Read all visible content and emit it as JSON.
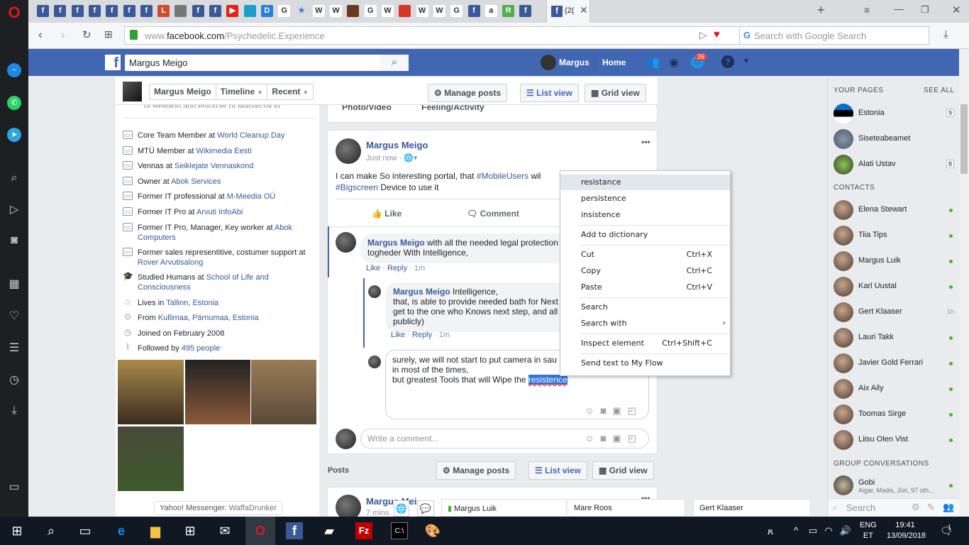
{
  "browser": {
    "active_tab_title": "(2(",
    "url_prefix": "www.",
    "url_domain": "facebook.com",
    "url_path": "/Psychedelic.Experience",
    "search_placeholder": "Search with Google Search",
    "new_tab": "+",
    "tab_icons": [
      "f",
      "f",
      "f",
      "f",
      "f",
      "f",
      "f",
      "L",
      "doc",
      "f",
      "f",
      "youtube",
      "blue",
      "D",
      "G",
      "★",
      "W",
      "W",
      "brown",
      "G",
      "W",
      "red",
      "W",
      "W",
      "G",
      "f",
      "a",
      "R",
      "f",
      "f"
    ]
  },
  "fb_header": {
    "search_value": "Margus Meigo",
    "user_name": "Margus",
    "home": "Home",
    "notification_count": "26",
    "brand_color": "#4267b2"
  },
  "profile_bar": {
    "name": "Margus Meigo",
    "timeline": "Timeline",
    "recent": "Recent",
    "manage_posts": "Manage posts",
    "list_view": "List view",
    "grid_view": "Grid view"
  },
  "intro": {
    "cut_text": "of Religion and enforcer of Manarchy in",
    "items": [
      {
        "icon": "briefcase",
        "text": "Core Team Member at ",
        "link": "World Cleanup Day"
      },
      {
        "icon": "briefcase",
        "text": "MTÜ Member at ",
        "link": "Wikimedia Eesti"
      },
      {
        "icon": "briefcase",
        "text": "Vennas at ",
        "link": "Seiklejate Vennaskond"
      },
      {
        "icon": "briefcase",
        "text": "Owner at ",
        "link": "Abok Services"
      },
      {
        "icon": "briefcase",
        "text": "Former IT professional at ",
        "link": "M-Meedia OÜ"
      },
      {
        "icon": "briefcase",
        "text": "Former IT Pro at ",
        "link": "Arvuti InfoAbi"
      },
      {
        "icon": "briefcase",
        "text": "Former IT Pro, Manager, Key worker at ",
        "link": "Abok Computers"
      },
      {
        "icon": "briefcase",
        "text": "Former sales representitive, costumer support at ",
        "link": "Rover Arvutisalong"
      },
      {
        "icon": "graduation-cap",
        "text": "Studied Humans at ",
        "link": "School of Life and Consciousness"
      },
      {
        "icon": "home",
        "text": "Lives in ",
        "link": "Tallinn, Estonia"
      },
      {
        "icon": "pin",
        "text": "From ",
        "link": "Kullimaa, Pärnumaa, Estonia"
      },
      {
        "icon": "clock",
        "text": "Joined on February 2008",
        "link": ""
      },
      {
        "icon": "rss",
        "text": "Followed by ",
        "link": "495 people"
      }
    ],
    "yahoo_label": "Yahoo! Messenger: ",
    "yahoo_value": "WaffaDrunker"
  },
  "composer": {
    "photo_video": "Photo/Video",
    "feeling": "Feeling/Activity"
  },
  "post": {
    "author": "Margus Meigo",
    "time": "Just now",
    "text_before": "I can make So interesting portal, that ",
    "hashtag1": "#MobileUsers",
    "text_mid": " wil",
    "hashtag2": "#Bigscreen",
    "text_after": " Device to use it",
    "like": "Like",
    "comment": "Comment",
    "comments": [
      {
        "author": "Margus Meigo",
        "text": " with all the needed legal protection",
        "text2": "togheder With Intelligence,",
        "like": "Like",
        "reply": "Reply",
        "time": "1m"
      },
      {
        "author": "Margus Meigo",
        "text": " Intelligence,",
        "text2": "that, is able to provide needed bath for Next",
        "text3": "get to the one who Knows next step, and all",
        "text4": "publicly)",
        "like": "Like",
        "reply": "Reply",
        "time": "1m"
      }
    ],
    "draft_line1": "surely, we will not start to put camera in sau",
    "draft_line2": "in most of the times,",
    "draft_line3": "but greatest Tools that will Wipe the ",
    "draft_selected": "resistence",
    "write_placeholder": "Write a comment..."
  },
  "posts_section": {
    "label": "Posts",
    "manage_posts": "Manage posts",
    "list_view": "List view",
    "grid_view": "Grid view",
    "next_author": "Margus Mei",
    "next_time": "7 mins"
  },
  "context_menu": {
    "suggestions": [
      "resistance",
      "persistence",
      "insistence"
    ],
    "add_to_dictionary": "Add to dictionary",
    "cut": "Cut",
    "cut_sc": "Ctrl+X",
    "copy": "Copy",
    "copy_sc": "Ctrl+C",
    "paste": "Paste",
    "paste_sc": "Ctrl+V",
    "search": "Search",
    "search_with": "Search with",
    "inspect": "Inspect element",
    "inspect_sc": "Ctrl+Shift+C",
    "send_flow": "Send text to My Flow"
  },
  "sidebar": {
    "your_pages": "YOUR PAGES",
    "see_all": "SEE ALL",
    "pages": [
      {
        "name": "Estonia",
        "badge": "9"
      },
      {
        "name": "Siseteabeamet",
        "badge": ""
      },
      {
        "name": "Alati Ustav",
        "badge": "8"
      }
    ],
    "contacts_label": "CONTACTS",
    "contacts": [
      {
        "name": "Elena Stewart",
        "status": "online"
      },
      {
        "name": "Tiia Tips",
        "status": "online"
      },
      {
        "name": "Margus Luik",
        "status": "online"
      },
      {
        "name": "Karl Uustal",
        "status": "online"
      },
      {
        "name": "Gert Klaaser",
        "status": "1h"
      },
      {
        "name": "Lauri Takk",
        "status": "online"
      },
      {
        "name": "Javier Gold Ferrari",
        "status": "online"
      },
      {
        "name": "Aix Aily",
        "status": "online"
      },
      {
        "name": "Toomas Sirge",
        "status": "online"
      },
      {
        "name": "Liisu Olen Vist",
        "status": "online"
      }
    ],
    "group_label": "GROUP CONVERSATIONS",
    "group_name": "Gobi",
    "group_members": "Aigar, Madis, Jüri, 97 oth...",
    "search_placeholder": "Search"
  },
  "chat_tabs": [
    "Margus Luik",
    "Mare Roos",
    "Gert Klaaser"
  ],
  "taskbar": {
    "lang1": "ENG",
    "lang2": "ET",
    "time": "19:41",
    "date": "13/09/2018",
    "notif": "1"
  }
}
